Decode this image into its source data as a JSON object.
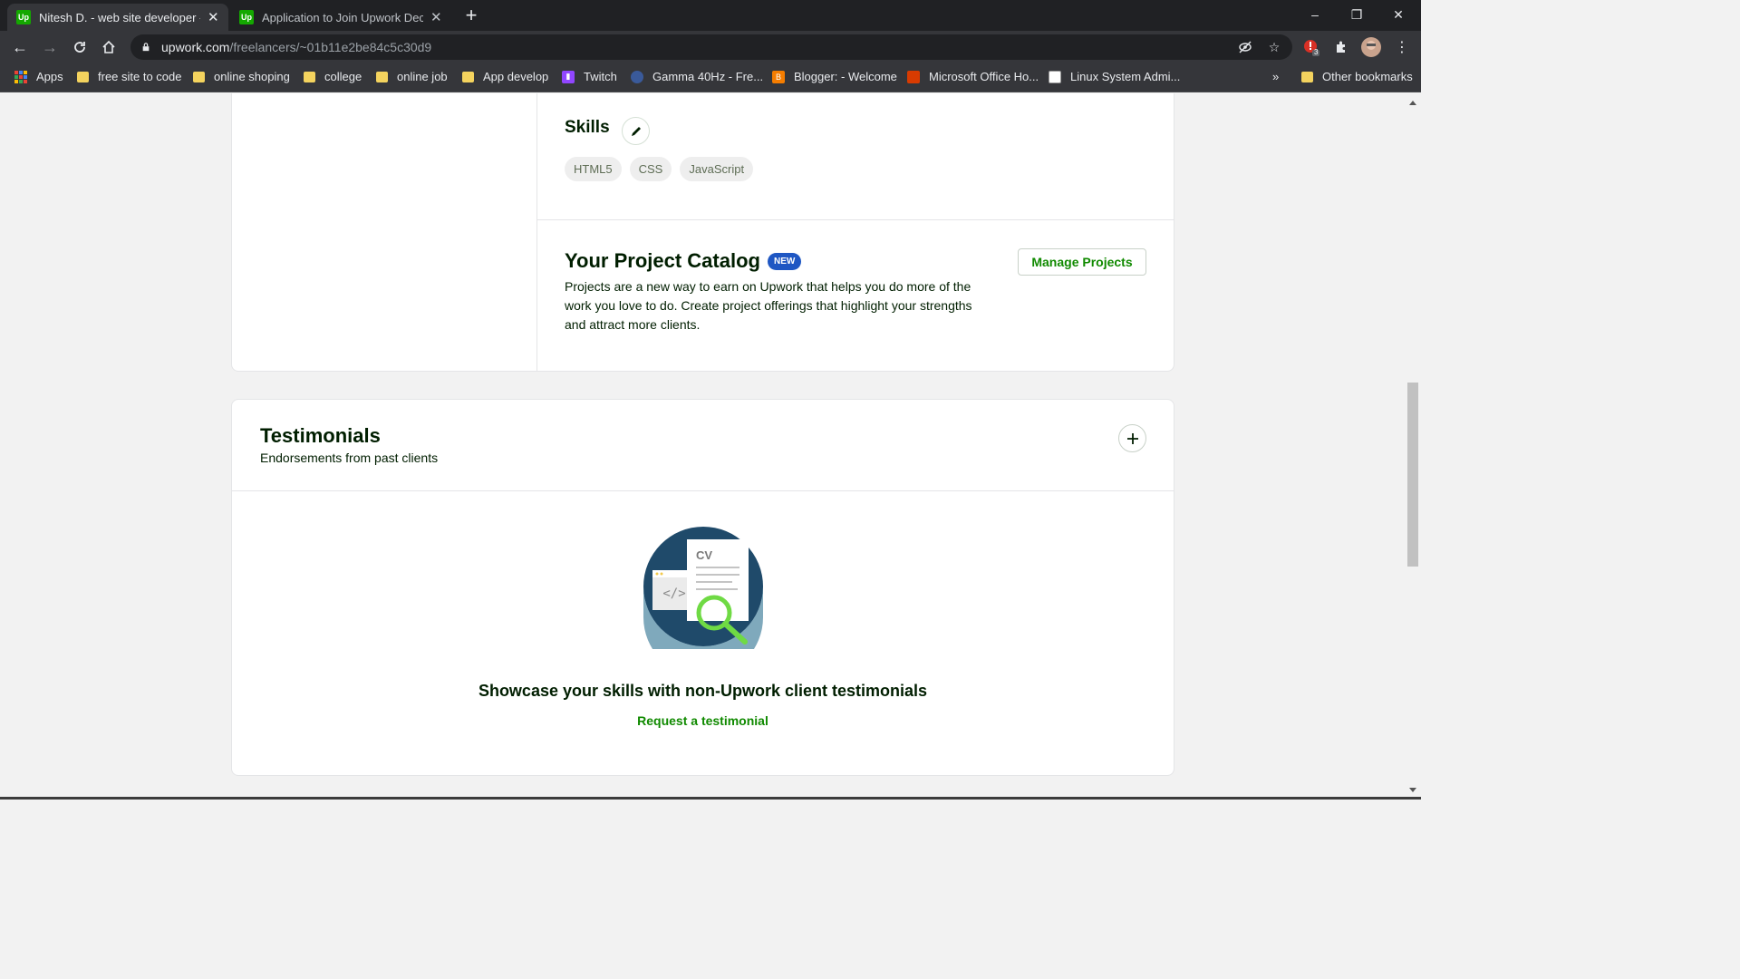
{
  "browser": {
    "tabs": [
      {
        "title": "Nitesh D. - web site developer - Upwork",
        "favicon": "Up"
      },
      {
        "title": "Application to Join Upwork Declined",
        "favicon": "Up"
      }
    ],
    "new_tab_label": "+",
    "window_controls": {
      "minimize": "–",
      "restore": "❐",
      "close": "✕"
    },
    "url_host": "upwork.com",
    "url_path": "/freelancers/~01b11e2be84c5c30d9",
    "extension_badge": "3",
    "bookmarks": [
      {
        "label": "Apps",
        "icon": "apps-grid-icon"
      },
      {
        "label": "free site to code",
        "icon": "folder-icon"
      },
      {
        "label": "online shoping",
        "icon": "folder-icon"
      },
      {
        "label": "college",
        "icon": "folder-icon"
      },
      {
        "label": "online job",
        "icon": "folder-icon"
      },
      {
        "label": "App develop",
        "icon": "folder-icon"
      },
      {
        "label": "Twitch",
        "icon": "twitch-icon"
      },
      {
        "label": "Gamma 40Hz - Fre...",
        "icon": "gamma-icon"
      },
      {
        "label": "Blogger: - Welcome",
        "icon": "blogger-icon"
      },
      {
        "label": "Microsoft Office Ho...",
        "icon": "office-icon"
      },
      {
        "label": "Linux System Admi...",
        "icon": "linux-icon"
      }
    ],
    "more_bookmarks": "»",
    "other_bookmarks": "Other bookmarks"
  },
  "skills": {
    "title": "Skills",
    "items": [
      "HTML5",
      "CSS",
      "JavaScript"
    ]
  },
  "catalog": {
    "title": "Your Project Catalog",
    "badge": "NEW",
    "description": "Projects are a new way to earn on Upwork that helps you do more of the work you love to do. Create project offerings that highlight your strengths and attract more clients.",
    "manage_label": "Manage Projects"
  },
  "testimonials": {
    "title": "Testimonials",
    "subtitle": "Endorsements from past clients",
    "illustration_text": "CV",
    "illustration_code": "</>",
    "showcase": "Showcase your skills with non-Upwork client testimonials",
    "request_link": "Request a testimonial"
  },
  "colors": {
    "brand_green": "#14a800",
    "link_green": "#108a00",
    "badge_blue": "#1f57c3",
    "chrome_dark": "#202124"
  }
}
